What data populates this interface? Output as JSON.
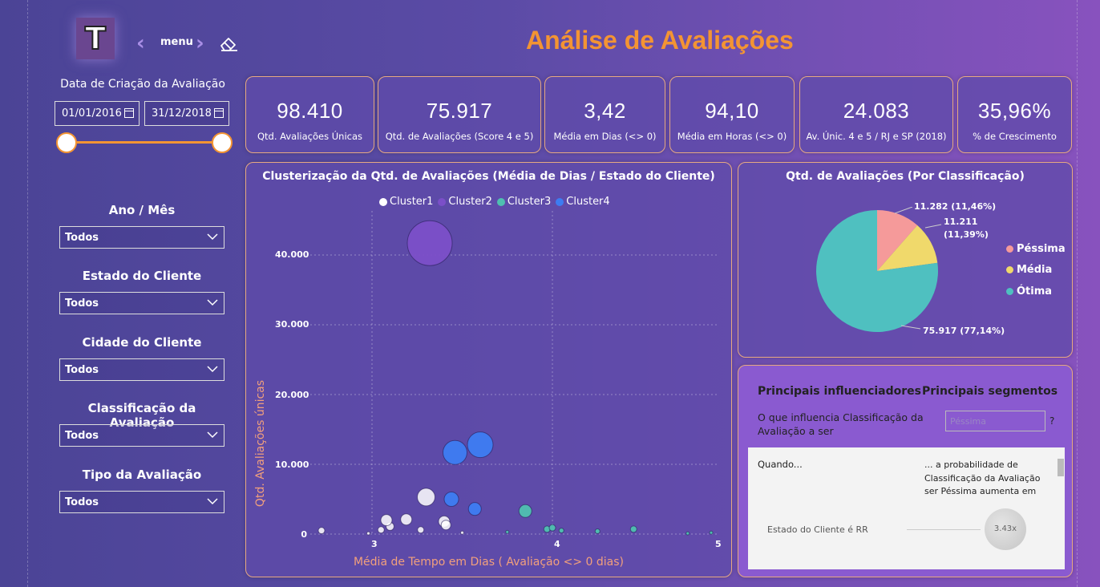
{
  "header": {
    "logo_letter": "T",
    "menu_label": "menu",
    "title": "Análise de Avaliações"
  },
  "date_filter": {
    "label": "Data de Criação da Avaliação",
    "start": "01/01/2016",
    "end": "31/12/2018"
  },
  "slicers": [
    {
      "label": "Ano / Mês",
      "value": "Todos"
    },
    {
      "label": "Estado do Cliente",
      "value": "Todos"
    },
    {
      "label": "Cidade do Cliente",
      "value": "Todos"
    },
    {
      "label": "Classificação da Avaliação",
      "value": "Todos"
    },
    {
      "label": "Tipo da Avaliação",
      "value": "Todos"
    }
  ],
  "cards": [
    {
      "value": "98.410",
      "label": "Qtd. Avaliações Únicas"
    },
    {
      "value": "75.917",
      "label": "Qtd. de Avaliações (Score 4 e 5)"
    },
    {
      "value": "3,42",
      "label": "Média em Dias (<> 0)"
    },
    {
      "value": "94,10",
      "label": "Média em Horas (<> 0)"
    },
    {
      "value": "24.083",
      "label": "Av. Únic. 4 e 5 / RJ e SP (2018)"
    },
    {
      "value": "35,96%",
      "label": "% de Crescimento"
    }
  ],
  "colors": {
    "accent": "#f39433",
    "cluster1": "#ffffff",
    "cluster2": "#7b4fc8",
    "cluster3": "#4fc0b0",
    "cluster4": "#3d7cf2",
    "pessima": "#f59a9a",
    "media": "#f0d96b",
    "otima": "#4fc0c0"
  },
  "scatter": {
    "title": "Clusterização da Qtd. de Avaliações (Média de Dias / Estado do Cliente)",
    "xlabel": "Média de Tempo em Dias ( Avaliação <> 0 dias)",
    "ylabel": "Qtd. Avaliações únicas",
    "legend": [
      "Cluster1",
      "Cluster2",
      "Cluster3",
      "Cluster4"
    ],
    "yticks": [
      "40.000",
      "30.000",
      "20.000",
      "10.000",
      "0"
    ],
    "xticks": [
      "3",
      "4",
      "5"
    ]
  },
  "pie": {
    "title": "Qtd. de Avaliações (Por Classificação)",
    "labels": {
      "pessima": "11.282 (11,46%)",
      "media_line1": "11.211",
      "media_line2": "(11,39%)",
      "otima": "75.917 (77,14%)"
    },
    "legend": [
      "Péssima",
      "Média",
      "Ótima"
    ]
  },
  "influencers": {
    "tab1": "Principais influenciadores",
    "tab2": "Principais segmentos",
    "question": "O que influencia Classificação da Avaliação a ser",
    "selected": "Péssima",
    "qmark": "?",
    "when": "Quando...",
    "probability": "... a probabilidade de Classificação da Avaliação ser Péssima aumenta em",
    "factor": "Estado do Cliente é RR",
    "multiplier": "3.43x"
  },
  "chart_data": [
    {
      "type": "scatter",
      "title": "Clusterização da Qtd. de Avaliações (Média de Dias / Estado do Cliente)",
      "xlabel": "Média de Tempo em Dias ( Avaliação <> 0 dias)",
      "ylabel": "Qtd. Avaliações únicas",
      "xlim": [
        2.8,
        5.0
      ],
      "ylim": [
        0,
        45000
      ],
      "grid": true,
      "legend_position": "top",
      "series": [
        {
          "name": "Cluster1",
          "points": [
            {
              "x": 2.72,
              "y": 500,
              "s": 4
            },
            {
              "x": 2.98,
              "y": 100,
              "s": 2
            },
            {
              "x": 3.05,
              "y": 600,
              "s": 4
            },
            {
              "x": 3.1,
              "y": 1100,
              "s": 5
            },
            {
              "x": 3.08,
              "y": 2000,
              "s": 7
            },
            {
              "x": 3.19,
              "y": 2100,
              "s": 7
            },
            {
              "x": 3.27,
              "y": 600,
              "s": 4
            },
            {
              "x": 3.3,
              "y": 5300,
              "s": 11
            },
            {
              "x": 3.4,
              "y": 1800,
              "s": 7
            },
            {
              "x": 3.41,
              "y": 1300,
              "s": 6
            },
            {
              "x": 3.5,
              "y": 200,
              "s": 2
            }
          ]
        },
        {
          "name": "Cluster2",
          "points": [
            {
              "x": 3.32,
              "y": 41700,
              "s": 28
            }
          ]
        },
        {
          "name": "Cluster3",
          "points": [
            {
              "x": 3.85,
              "y": 3300,
              "s": 8
            },
            {
              "x": 3.97,
              "y": 700,
              "s": 4
            },
            {
              "x": 4.0,
              "y": 900,
              "s": 4
            },
            {
              "x": 4.05,
              "y": 500,
              "s": 3
            },
            {
              "x": 4.25,
              "y": 400,
              "s": 3
            },
            {
              "x": 4.45,
              "y": 700,
              "s": 4
            },
            {
              "x": 4.75,
              "y": 100,
              "s": 2
            },
            {
              "x": 4.88,
              "y": 200,
              "s": 2
            },
            {
              "x": 3.75,
              "y": 300,
              "s": 2
            }
          ]
        },
        {
          "name": "Cluster4",
          "points": [
            {
              "x": 3.6,
              "y": 12800,
              "s": 16
            },
            {
              "x": 3.46,
              "y": 11700,
              "s": 15
            },
            {
              "x": 3.44,
              "y": 5000,
              "s": 9
            },
            {
              "x": 3.57,
              "y": 3600,
              "s": 8
            }
          ]
        }
      ]
    },
    {
      "type": "pie",
      "title": "Qtd. de Avaliações (Por Classificação)",
      "categories": [
        "Péssima",
        "Média",
        "Ótima"
      ],
      "values": [
        11282,
        11211,
        75917
      ],
      "legend_position": "right"
    }
  ]
}
